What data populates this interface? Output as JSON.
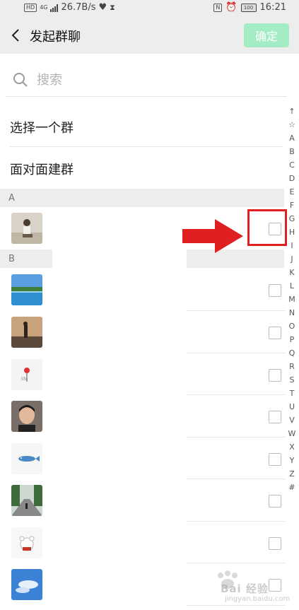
{
  "status_bar": {
    "hd": "HD",
    "network": "4G",
    "speed": "26.7B/s",
    "battery": "100",
    "time": "16:21"
  },
  "header": {
    "title": "发起群聊",
    "confirm_label": "确定"
  },
  "search": {
    "placeholder": "搜索"
  },
  "menu": {
    "select_group": "选择一个群",
    "face_to_face": "面对面建群"
  },
  "sections": [
    {
      "letter": "A",
      "contacts": [
        {
          "avatar": "photo-person-sitting"
        }
      ]
    },
    {
      "letter": "B",
      "contacts": [
        {
          "avatar": "photo-lake-landscape"
        },
        {
          "avatar": "photo-silhouette-sunset"
        },
        {
          "avatar": "drawing-red-flower"
        },
        {
          "avatar": "photo-boy-portrait"
        },
        {
          "avatar": "drawing-blue-fish"
        },
        {
          "avatar": "photo-road-trees"
        },
        {
          "avatar": "drawing-cute-bear"
        },
        {
          "avatar": "photo-blue-sky-clouds"
        }
      ]
    }
  ],
  "alpha_index": [
    "↑",
    "☆",
    "A",
    "B",
    "C",
    "D",
    "E",
    "F",
    "G",
    "H",
    "I",
    "J",
    "K",
    "L",
    "M",
    "N",
    "O",
    "P",
    "Q",
    "R",
    "S",
    "T",
    "U",
    "V",
    "W",
    "X",
    "Y",
    "Z",
    "#"
  ],
  "annotation": {
    "arrow_color": "#e02020",
    "box_color": "#e02020"
  },
  "watermark": {
    "text": "Bai 经验",
    "sub": "jingyan.baidu.com"
  },
  "colors": {
    "header_bg": "#ededed",
    "confirm_bg": "#a3ecc4",
    "section_bg": "#ededed"
  }
}
